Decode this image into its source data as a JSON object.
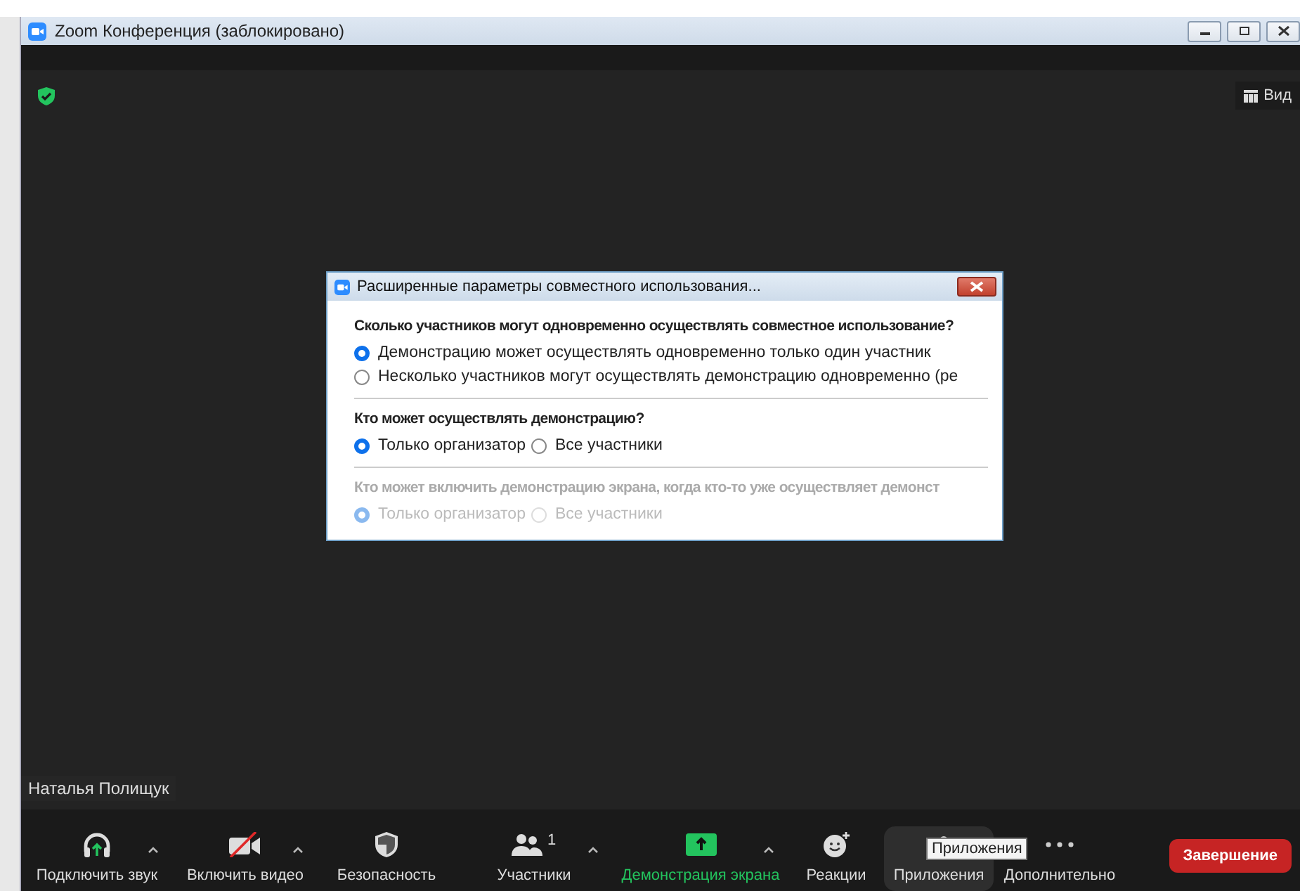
{
  "window": {
    "title": "Zoom Конференция (заблокировано)"
  },
  "view_button": "Вид",
  "dialog": {
    "title": "Расширенные параметры совместного использования...",
    "sections": [
      {
        "heading": "Сколько участников могут одновременно осуществлять совместное использование?",
        "disabled": false,
        "kind": "stacked",
        "options": [
          {
            "label": "Демонстрацию может осуществлять одновременно только один участник",
            "selected": true
          },
          {
            "label": "Несколько участников могут осуществлять демонстрацию одновременно (ре",
            "selected": false
          }
        ]
      },
      {
        "heading": "Кто может осуществлять демонстрацию?",
        "disabled": false,
        "kind": "inline",
        "options": [
          {
            "label": "Только организатор",
            "selected": true
          },
          {
            "label": "Все участники",
            "selected": false
          }
        ]
      },
      {
        "heading": "Кто может включить демонстрацию экрана, когда кто-то уже осуществляет демонст",
        "disabled": true,
        "kind": "inline",
        "options": [
          {
            "label": "Только организатор",
            "selected": true
          },
          {
            "label": "Все участники",
            "selected": false
          }
        ]
      }
    ]
  },
  "name_tag": "Наталья Полищук",
  "toolbar": [
    {
      "kind": "audio",
      "label": "Подключить звук",
      "caret": true,
      "active": false,
      "hovered": false
    },
    {
      "kind": "video",
      "label": "Включить видео",
      "caret": true,
      "active": false,
      "hovered": false
    },
    {
      "kind": "security",
      "label": "Безопасность",
      "caret": false,
      "active": false,
      "hovered": false
    },
    {
      "kind": "participants",
      "label": "Участники",
      "badge": "1",
      "caret": true,
      "active": false,
      "hovered": false
    },
    {
      "kind": "share",
      "label": "Демонстрация экрана",
      "caret": true,
      "active": true,
      "hovered": false
    },
    {
      "kind": "reactions",
      "label": "Реакции",
      "caret": false,
      "active": false,
      "hovered": false
    },
    {
      "kind": "apps",
      "label": "Приложения",
      "caret": false,
      "active": false,
      "hovered": true
    },
    {
      "kind": "more",
      "label": "Дополнительно",
      "caret": false,
      "active": false,
      "hovered": false
    }
  ],
  "tooltip": "Приложения",
  "end_button": "Завершение"
}
